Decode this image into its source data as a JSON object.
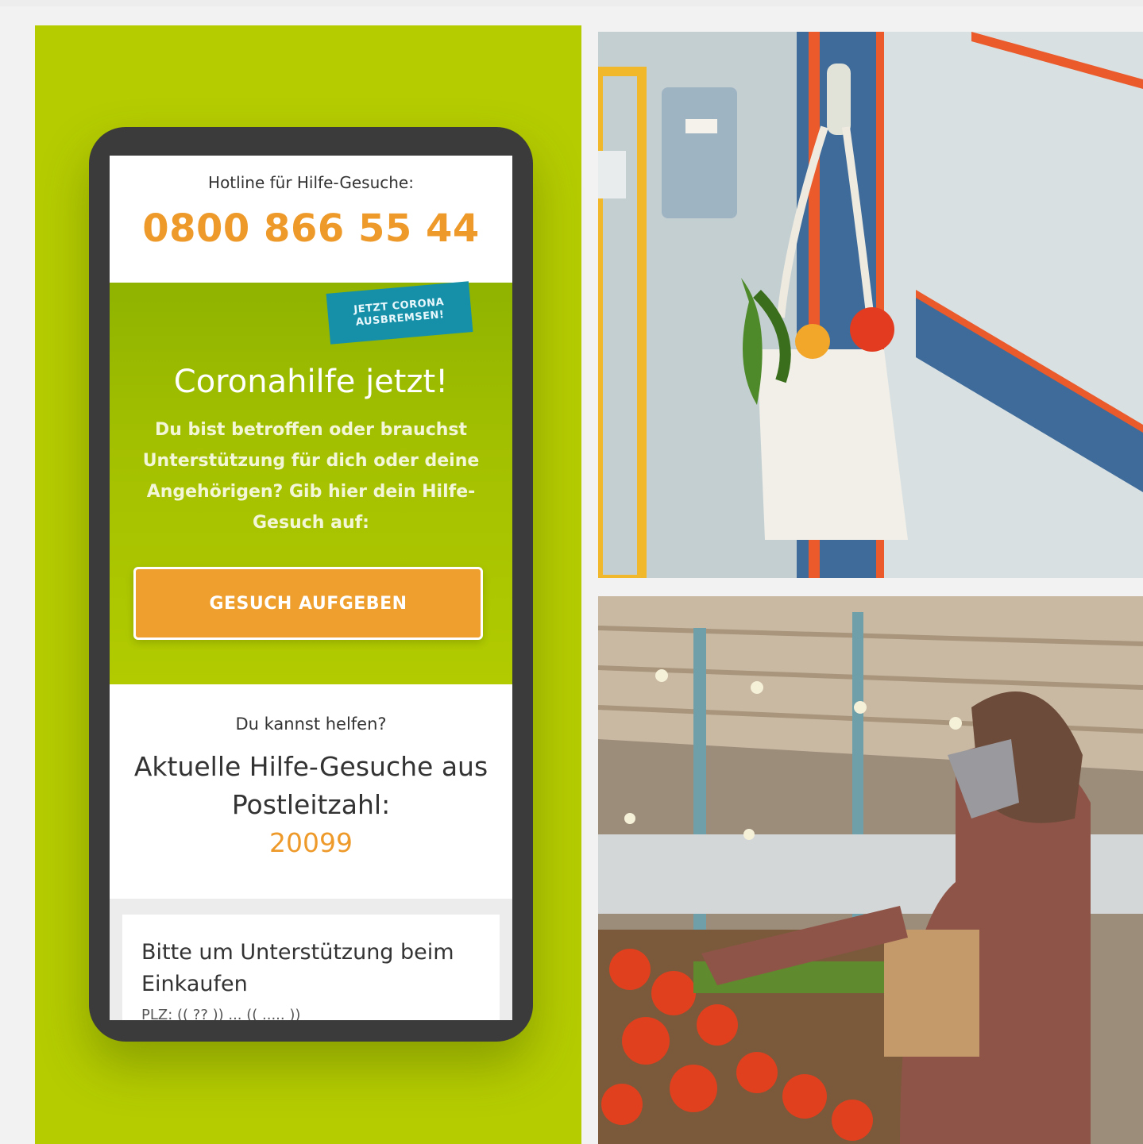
{
  "hotline": {
    "label": "Hotline für Hilfe-Gesuche:",
    "number": "0800 866 55 44"
  },
  "badge": {
    "line1": "JETZT CORONA",
    "line2": "AUSBREMSEN!"
  },
  "hero": {
    "title": "Coronahilfe jetzt!",
    "text": "Du bist betroffen oder brauchst Unterstützung für dich oder deine Angehörigen? Gib hier dein Hilfe-Gesuch auf:",
    "cta_label": "GESUCH AUFGEBEN"
  },
  "help": {
    "subtitle": "Du kannst helfen?",
    "title": "Aktuelle Hilfe-Gesuche aus Postleitzahl:",
    "postal_code": "20099"
  },
  "card": {
    "title": "Bitte um Unterstützung beim Einkaufen",
    "meta": "PLZ: (( ?? ))  ...  (( ..... ))"
  },
  "colors": {
    "green": "#b5cc00",
    "orange": "#ee9a2a",
    "badge": "#1590a8"
  }
}
